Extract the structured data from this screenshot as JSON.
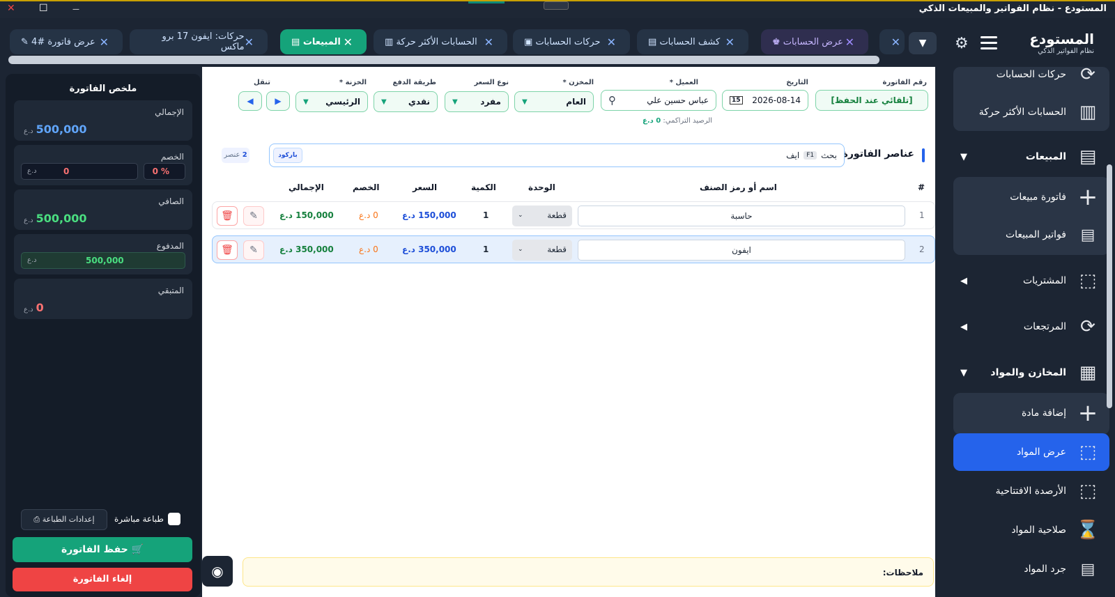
{
  "window": {
    "title": "المستودع - نظام الفواتير والمبيعات الذكي",
    "close": "✕",
    "maximize": "☐",
    "minimize": "—"
  },
  "brand": {
    "title": "المستودع",
    "subtitle": "نظام الفواتير الذكي"
  },
  "tabs": [
    {
      "label": "عرض فاتورة #4",
      "icon": "pencil-icon",
      "glyph": "✎"
    },
    {
      "label": "حركات: ايفون 17 برو ماكس",
      "icon": "",
      "glyph": ""
    },
    {
      "label": "المبيعات",
      "icon": "receipt-icon",
      "glyph": "🧾",
      "active": true
    },
    {
      "label": "الحسابات الأكثر حركة",
      "icon": "chart-icon",
      "glyph": "▥"
    },
    {
      "label": "حركات الحسابات",
      "icon": "safe-icon",
      "glyph": "▣"
    },
    {
      "label": "كشف الحسابات",
      "icon": "document-icon",
      "glyph": "▤"
    },
    {
      "label": "عرض الحسابات",
      "icon": "users-icon",
      "glyph": "👥"
    }
  ],
  "sidebar": {
    "items": [
      {
        "label": "حركات الحسابات",
        "icon": "refresh-icon",
        "glyph": "⟳"
      },
      {
        "label": "الحسابات الأكثر حركة",
        "icon": "bar-chart-icon",
        "glyph": "▥"
      },
      {
        "label": "المبيعات",
        "icon": "receipt-icon",
        "glyph": "▤",
        "arrow": "▼"
      },
      {
        "label": "فاتورة مبيعات",
        "icon": "plus-icon",
        "glyph": "+"
      },
      {
        "label": "فواتير المبيعات",
        "icon": "clipboard-icon",
        "glyph": "📋"
      },
      {
        "label": "المشتريات",
        "icon": "box-icon",
        "glyph": "⬚",
        "arrow": "◀"
      },
      {
        "label": "المرتجعات",
        "icon": "refresh-icon",
        "glyph": "⟳",
        "arrow": "◀"
      },
      {
        "label": "المخازن والمواد",
        "icon": "building-icon",
        "glyph": "▦",
        "arrow": "▼"
      },
      {
        "label": "إضافة مادة",
        "icon": "plus-icon",
        "glyph": "+"
      },
      {
        "label": "عرض المواد",
        "icon": "box-icon",
        "glyph": "⬚"
      },
      {
        "label": "الأرصدة الافتتاحية",
        "icon": "boxes-icon",
        "glyph": "⬚"
      },
      {
        "label": "صلاحية المواد",
        "icon": "hourglass-icon",
        "glyph": "⌛"
      },
      {
        "label": "جرد المواد",
        "icon": "clipboard-icon",
        "glyph": "📋"
      }
    ]
  },
  "form": {
    "invoice_no": {
      "label": "رقم الفاتورة",
      "value": "[تلقائي عند الحفظ]"
    },
    "date": {
      "label": "التاريخ",
      "value": "2026-08-14",
      "calendar_day": "15"
    },
    "customer": {
      "label": "العميل *",
      "value": "عباس حسين علي"
    },
    "warehouse": {
      "label": "المخزن *",
      "value": "العام"
    },
    "price_type": {
      "label": "نوع السعر",
      "value": "مفرد"
    },
    "payment": {
      "label": "طريقة الدفع",
      "value": "نقدي"
    },
    "treasury": {
      "label": "الخزنة *",
      "value": "الرئيسي"
    },
    "nav": {
      "label": "تنقل",
      "prev": "◀",
      "next": "▶"
    },
    "balance_text": "الرصيد التراكمي:",
    "balance_value": "0 د.ع"
  },
  "items_section": {
    "title": "عناصر الفاتورة",
    "search_label": "بحث",
    "search_key": "F1",
    "search_value": "ايف",
    "barcode": "باركود",
    "count_num": "2",
    "count_label": "عنصر"
  },
  "table": {
    "headers": {
      "num": "#",
      "name": "اسم أو رمز الصنف",
      "unit": "الوحدة",
      "qty": "الكمية",
      "price": "السعر",
      "discount": "الخصم",
      "total": "الإجمالي"
    },
    "rows": [
      {
        "num": "1",
        "name": "حاسبة",
        "unit": "قطعة",
        "qty": "1",
        "price": "150,000 د.ع",
        "discount": "0 د.ع",
        "total": "150,000 د.ع"
      },
      {
        "num": "2",
        "name": "ايفون",
        "unit": "قطعة",
        "qty": "1",
        "price": "350,000 د.ع",
        "discount": "0 د.ع",
        "total": "350,000 د.ع"
      }
    ]
  },
  "notes_label": "ملاحظات:",
  "summary": {
    "title": "ملخص الفاتورة",
    "total_label": "الإجمالي",
    "total_value": "500,000",
    "currency": "د.ع",
    "discount_label": "الخصم",
    "discount_pct": "0",
    "pct_sign": "%",
    "discount_amount": "0",
    "net_label": "الصافي",
    "net_value": "500,000",
    "paid_label": "المدفوع",
    "paid_value": "500,000",
    "remaining_label": "المتبقي",
    "remaining_value": "0",
    "direct_print": "طباعة مباشرة",
    "print_settings": "إعدادات الطباعة",
    "save": "حفظ الفاتورة",
    "cancel": "إلغاء الفاتورة"
  },
  "colors": {
    "accent": "#15a37a",
    "primary": "#2563eb",
    "danger": "#ef4444",
    "dark": "#1c2533"
  }
}
